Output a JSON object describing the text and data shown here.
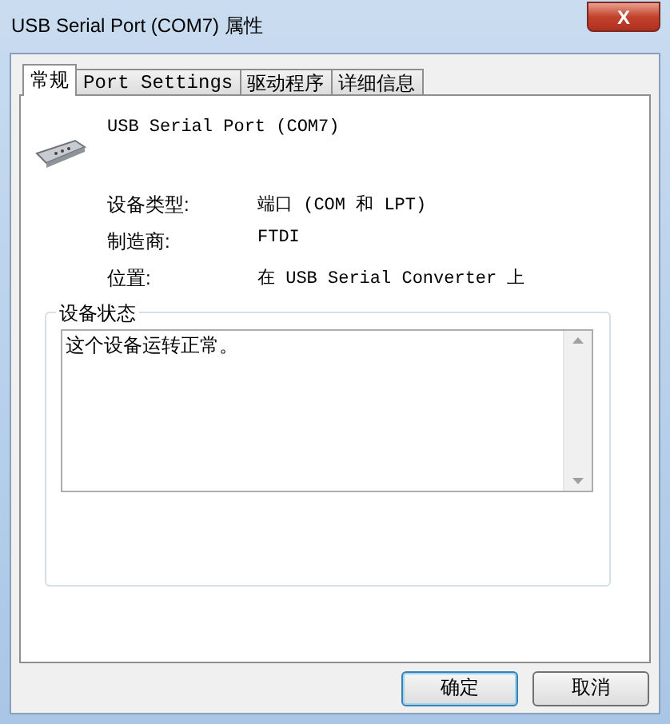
{
  "window": {
    "title": "USB Serial Port (COM7) 属性",
    "close": "X"
  },
  "tabs": [
    {
      "label": "常规",
      "selected": true
    },
    {
      "label": "Port Settings",
      "selected": false
    },
    {
      "label": "驱动程序",
      "selected": false
    },
    {
      "label": "详细信息",
      "selected": false
    }
  ],
  "device": {
    "name": "USB Serial Port (COM7)"
  },
  "properties": [
    {
      "label": "设备类型:",
      "value": "端口 (COM 和 LPT)"
    },
    {
      "label": "制造商:",
      "value": "FTDI"
    },
    {
      "label": "位置:",
      "value": "在 USB Serial Converter 上"
    }
  ],
  "status": {
    "title": "设备状态",
    "text": "这个设备运转正常。"
  },
  "buttons": [
    {
      "label": "确定",
      "default": true
    },
    {
      "label": "取消",
      "default": false
    }
  ]
}
